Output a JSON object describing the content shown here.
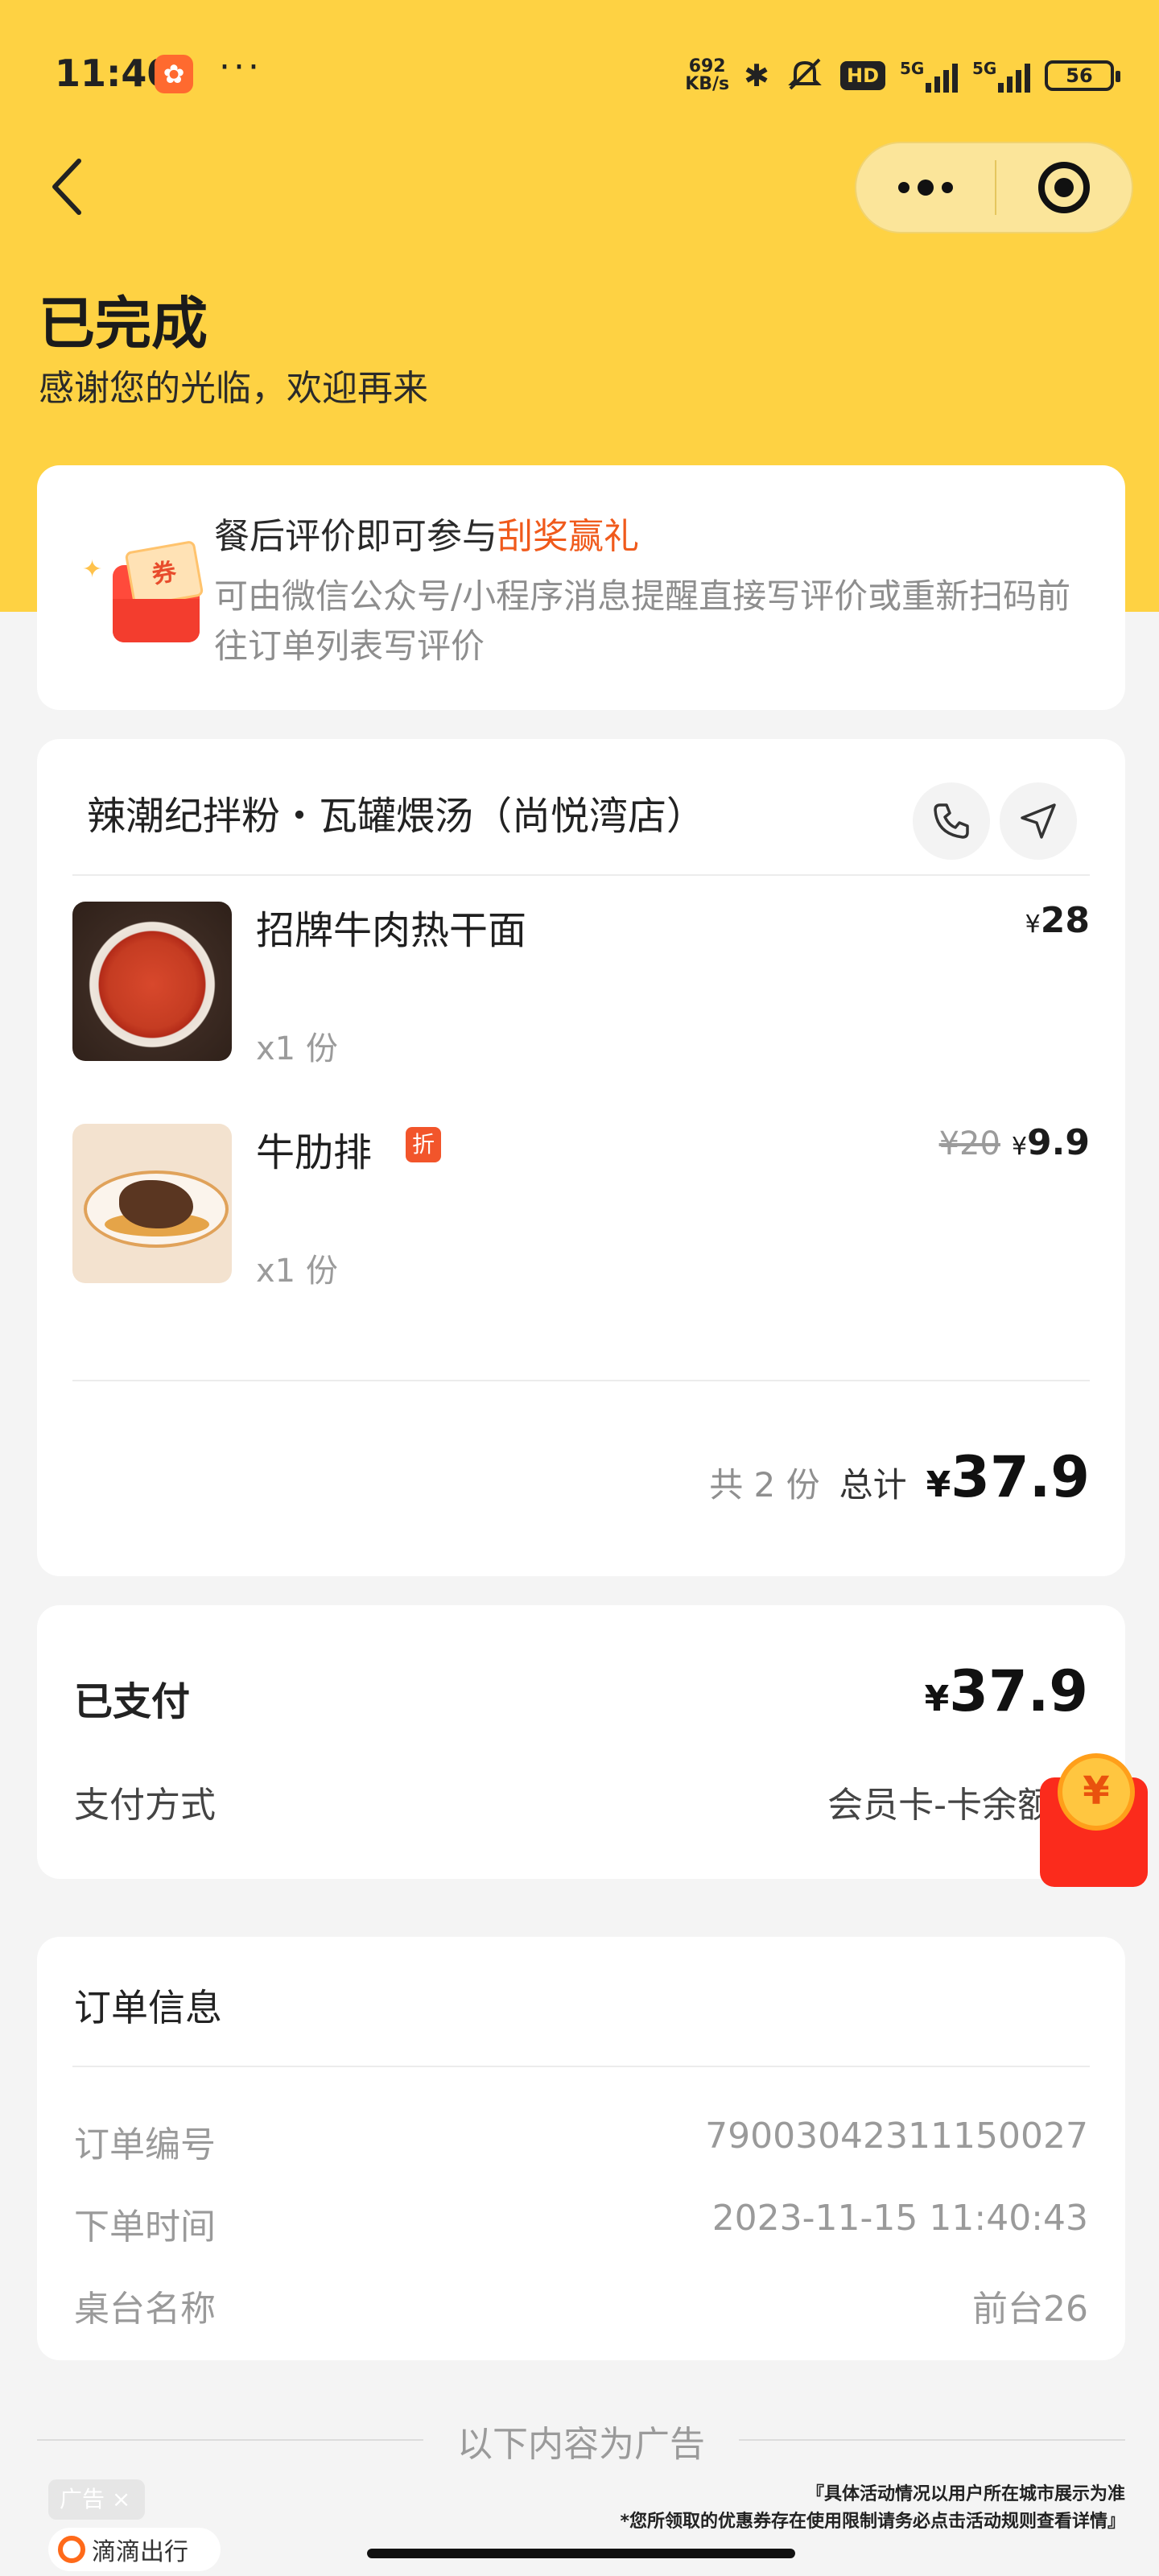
{
  "status_bar": {
    "time": "11:40",
    "app_glyph": "✿",
    "more_dots": "···",
    "net_speed_value": "692",
    "net_speed_unit": "KB/s",
    "bluetooth_glyph": "✱",
    "hd_label": "HD",
    "signal_label_1": "5G",
    "signal_label_2": "5G",
    "battery": "56"
  },
  "header": {
    "title": "已完成",
    "subtitle": "感谢您的光临，欢迎再来"
  },
  "promo": {
    "coupon_label": "券",
    "title_prefix": "餐后评价即可参与",
    "title_highlight": "刮奖赢礼",
    "description": "可由微信公众号/小程序消息提醒直接写评价或重新扫码前往订单列表写评价"
  },
  "order": {
    "shop_name": "辣潮纪拌粉・瓦罐煨汤（尚悦湾店）",
    "currency": "¥",
    "items": [
      {
        "name": "招牌牛肉热干面",
        "qty": "x1 份",
        "price": "28",
        "original_price": ""
      },
      {
        "name": "牛肋排",
        "qty": "x1 份",
        "price": "9.9",
        "original_price": "¥20",
        "tag": "折"
      }
    ],
    "count_text": "共 2 份",
    "total_label": "总计",
    "total_value": "37.9"
  },
  "payment": {
    "status_label": "已支付",
    "amount": "37.9",
    "method_label": "支付方式",
    "method_value": "会员卡-卡余额消",
    "red_packet_glyph": "¥"
  },
  "order_info": {
    "title": "订单信息",
    "rows": [
      {
        "label": "订单编号",
        "value": "79003042311150027"
      },
      {
        "label": "下单时间",
        "value": "2023-11-15 11:40:43"
      },
      {
        "label": "桌台名称",
        "value": "前台26"
      }
    ]
  },
  "ad": {
    "divider_text": "以下内容为广告",
    "badge": "广告 ×",
    "brand": "滴滴出行",
    "note_line1": "『具体活动情况以用户所在城市展示为准",
    "note_line2": "*您所领取的优惠券存在使用限制请务必点击活动规则查看详情』"
  },
  "colors": {
    "header_yellow": "#fed243",
    "highlight_orange": "#f05a1c",
    "discount_tag": "#f2552b",
    "red_packet": "#fb2b1c"
  }
}
